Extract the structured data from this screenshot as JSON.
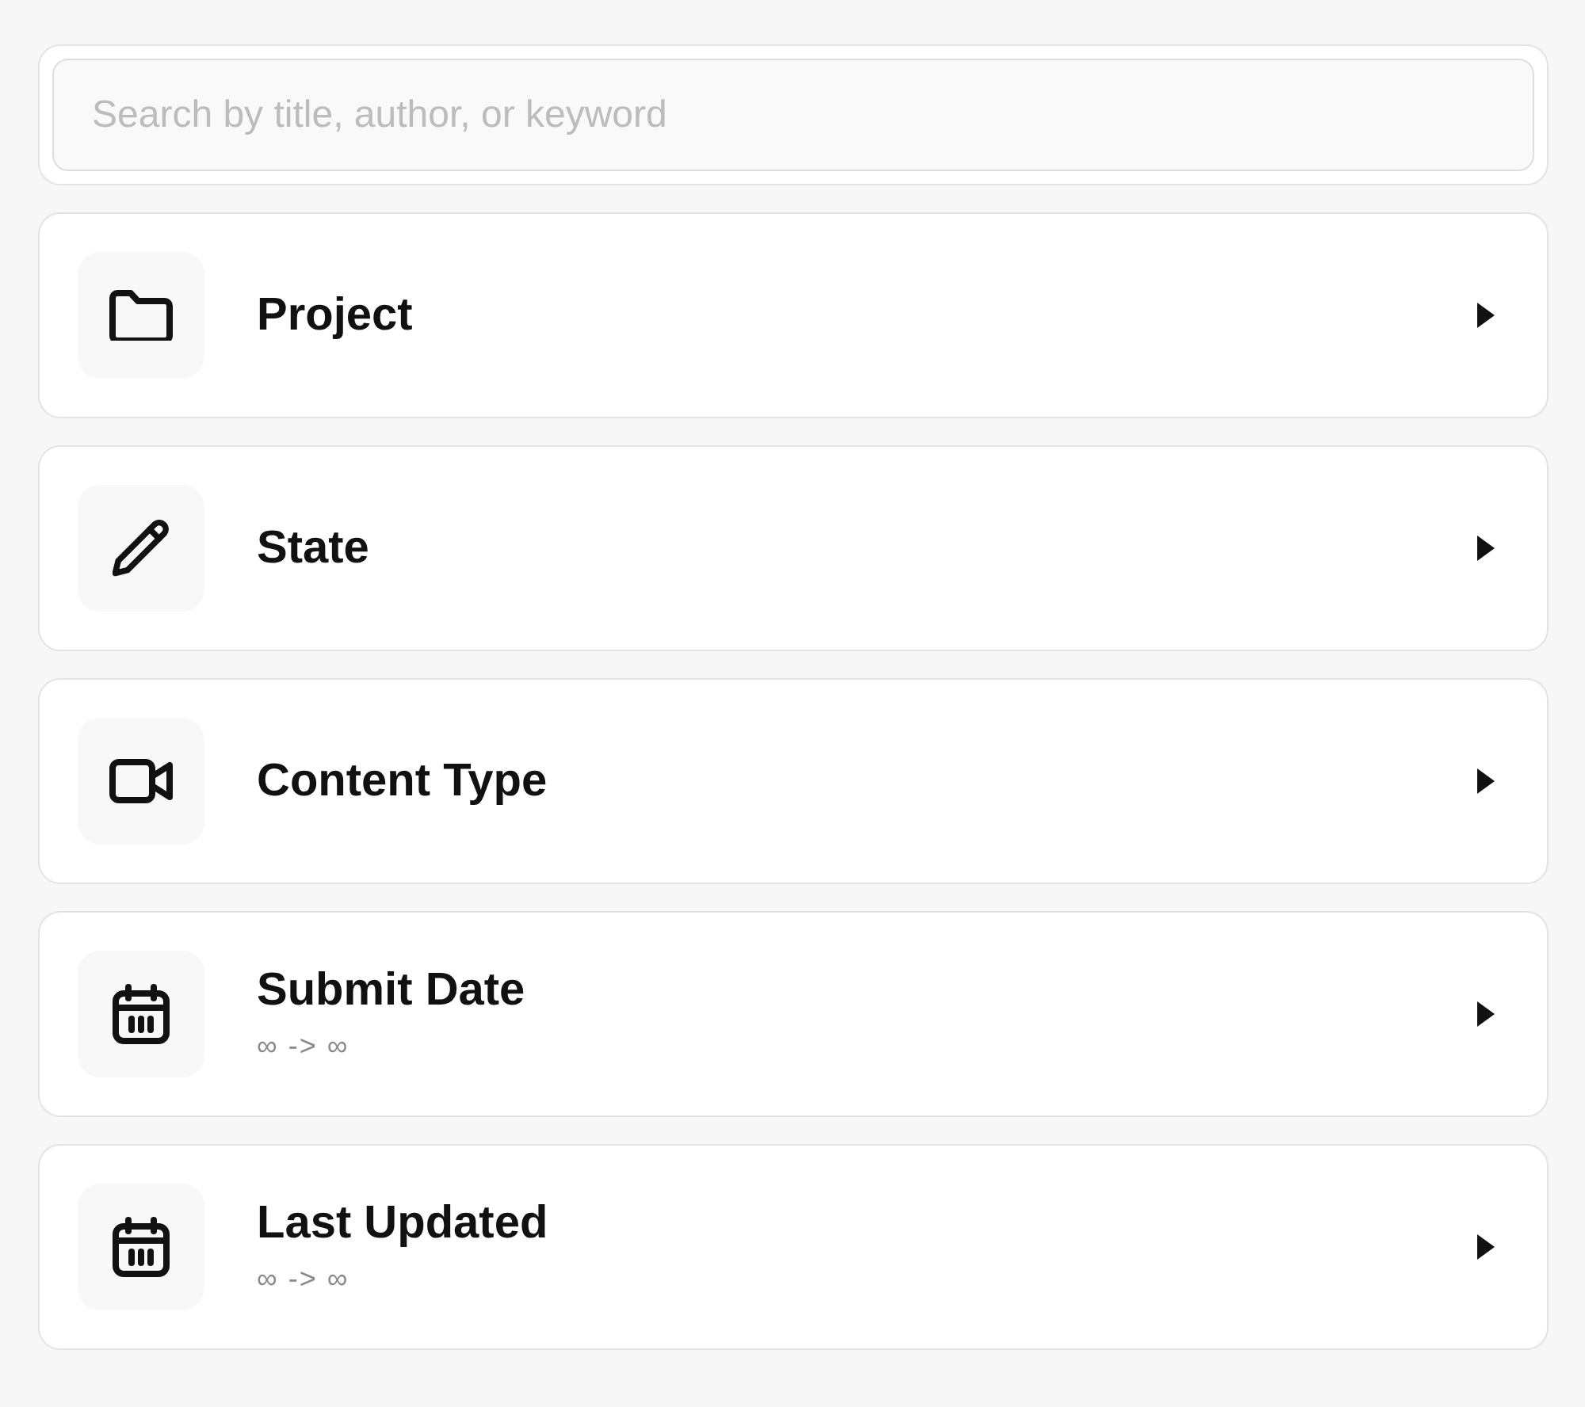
{
  "search": {
    "placeholder": "Search by title, author, or keyword"
  },
  "filters": [
    {
      "label": "Project"
    },
    {
      "label": "State"
    },
    {
      "label": "Content Type"
    },
    {
      "label": "Submit Date",
      "range": "∞ -> ∞"
    },
    {
      "label": "Last Updated",
      "range": "∞ -> ∞"
    }
  ]
}
